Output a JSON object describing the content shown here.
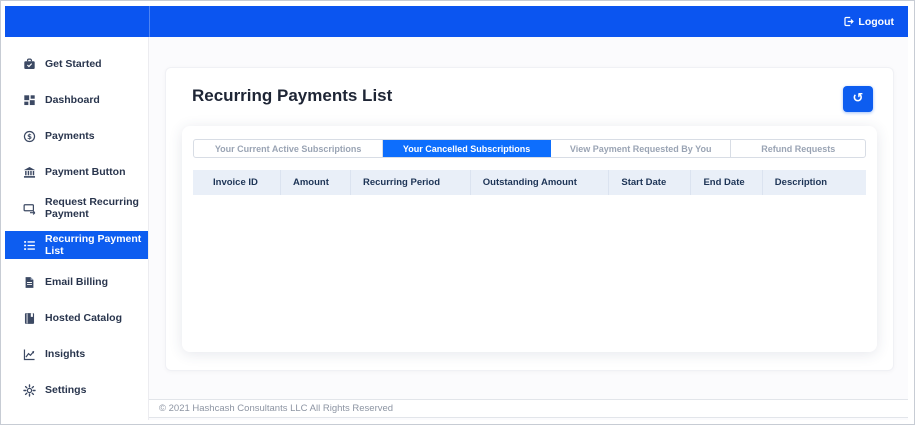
{
  "topbar": {
    "logout": {
      "label": "Logout",
      "icon": "logout-icon"
    }
  },
  "sidebar": {
    "items": [
      {
        "label": "Get Started",
        "icon": "briefcase-check-icon",
        "active": false
      },
      {
        "label": "Dashboard",
        "icon": "grid-icon",
        "active": false
      },
      {
        "label": "Payments",
        "icon": "dollar-circle-icon",
        "active": false
      },
      {
        "label": "Payment Button",
        "icon": "bank-icon",
        "active": false
      },
      {
        "label": "Request Recurring Payment",
        "icon": "card-request-icon",
        "active": false
      },
      {
        "label": "Recurring Payment List",
        "icon": "list-icon",
        "active": true
      },
      {
        "label": "Email Billing",
        "icon": "document-icon",
        "active": false
      },
      {
        "label": "Hosted Catalog",
        "icon": "catalog-icon",
        "active": false
      },
      {
        "label": "Insights",
        "icon": "chart-line-icon",
        "active": false
      },
      {
        "label": "Settings",
        "icon": "gear-icon",
        "active": false
      }
    ]
  },
  "main": {
    "title": "Recurring Payments List",
    "refresh_button": {
      "icon": "history-icon",
      "glyph": "↺"
    },
    "active_tab_index": 1,
    "tabs": [
      {
        "label": "Your Current Active Subscriptions",
        "active": false
      },
      {
        "label": "Your Cancelled Subscriptions",
        "active": true
      },
      {
        "label": "View Payment Requested By You",
        "active": false
      },
      {
        "label": "Refund Requests",
        "active": false
      }
    ],
    "table": {
      "columns": [
        "Invoice ID",
        "Amount",
        "Recurring Period",
        "Outstanding Amount",
        "Start Date",
        "End Date",
        "Description"
      ],
      "rows": []
    }
  },
  "footer": {
    "copyright": "© 2021 Hashcash Consultants LLC All Rights Reserved"
  },
  "colors": {
    "topbar_blue": "#0b55f0",
    "active_blue": "#0d6efd",
    "sidebar_active_blue": "#0d5df0",
    "table_header_bg": "#e9eff8"
  }
}
